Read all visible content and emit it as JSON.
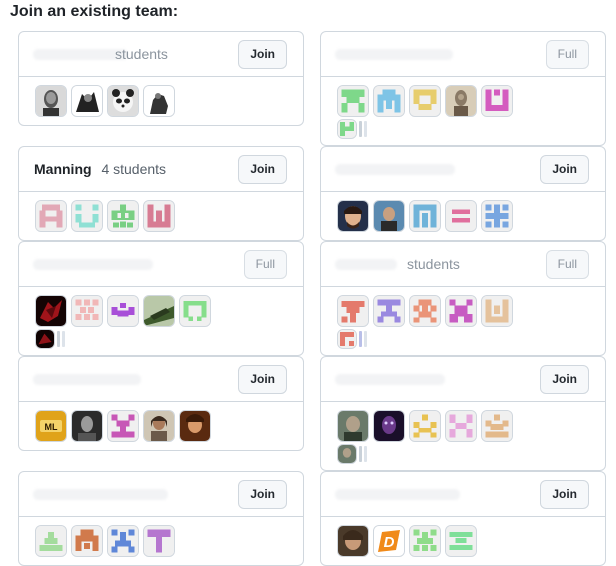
{
  "heading": "Join an existing team:",
  "teams": [
    {
      "name": "",
      "count": "students",
      "button": "Join",
      "full": false
    },
    {
      "name": "",
      "count": "",
      "button": "Full",
      "full": true
    },
    {
      "name": "Manning",
      "count": "4 students",
      "button": "Join",
      "full": false
    },
    {
      "name": "",
      "count": "",
      "button": "Join",
      "full": false
    },
    {
      "name": "",
      "count": "",
      "button": "Full",
      "full": true
    },
    {
      "name": "",
      "count": "students",
      "button": "Full",
      "full": true
    },
    {
      "name": "",
      "count": "",
      "button": "Join",
      "full": false
    },
    {
      "name": "",
      "count": "",
      "button": "Join",
      "full": false
    },
    {
      "name": "",
      "count": "",
      "button": "Join",
      "full": false
    },
    {
      "name": "",
      "count": "",
      "button": "Join",
      "full": false
    }
  ],
  "colors": {
    "border": "#d0d7de",
    "button_bg": "#f6f8fa",
    "identicon_green": "#7dd184",
    "identicon_pink": "#d87a93",
    "identicon_teal": "#87ddd0",
    "identicon_blue": "#6f9ed8",
    "identicon_purple": "#a86bd6",
    "identicon_orange": "#e08d65",
    "identicon_tan": "#dcb78a"
  }
}
